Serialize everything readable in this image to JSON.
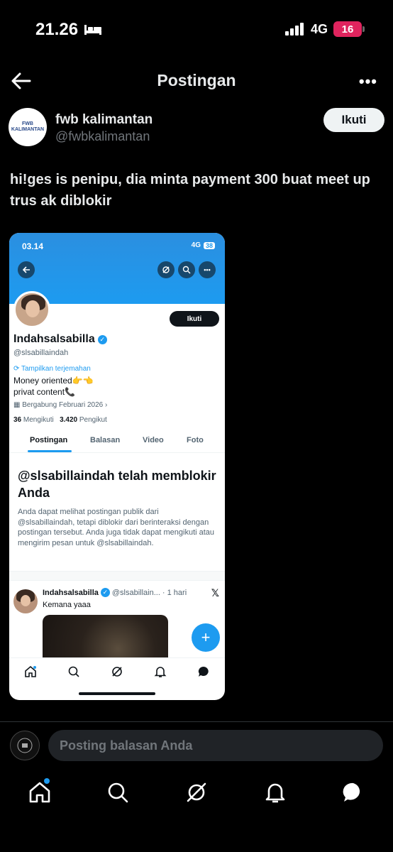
{
  "status_bar": {
    "time": "21.26",
    "network": "4G",
    "battery": "16"
  },
  "header": {
    "title": "Postingan"
  },
  "author": {
    "name": "fwb kalimantan",
    "handle": "@fwbkalimantan",
    "avatar_text": "FWB KALIMANTAN",
    "follow_label": "Ikuti"
  },
  "post": {
    "text": "hi!ges is penipu, dia minta payment 300 buat meet up trus ak diblokir"
  },
  "screenshot": {
    "status_time": "03.14",
    "status_network": "4G",
    "status_battery": "38",
    "profile": {
      "name": "Indahsalsabilla",
      "handle": "@slsabillaindah",
      "follow_label": "Ikuti",
      "translate": "Tampilkan terjemahan",
      "bio_line1": "Money oriented👉👈",
      "bio_line2": "privat content📞",
      "joined": "Bergabung Februari 2026",
      "following_count": "36",
      "following_label": "Mengikuti",
      "followers_count": "3.420",
      "followers_label": "Pengikut"
    },
    "tabs": [
      "Postingan",
      "Balasan",
      "Video",
      "Foto"
    ],
    "blocked_title": "@slsabillaindah telah memblokir Anda",
    "blocked_desc": "Anda dapat melihat postingan publik dari @slsabillaindah, tetapi diblokir dari berinteraksi dengan postingan tersebut. Anda juga tidak dapat mengikuti atau mengirim pesan untuk @slsabillaindah.",
    "tweet": {
      "name": "Indahsalsabilla",
      "handle": "@slsabillain...",
      "time": "· 1 hari",
      "text": "Kemana yaaa"
    },
    "fab": "+"
  },
  "reply": {
    "placeholder": "Posting balasan Anda"
  },
  "icons": [
    "back-arrow-icon",
    "more-icon",
    "home-icon",
    "search-icon",
    "grok-icon",
    "bell-icon",
    "message-icon"
  ],
  "colors": {
    "accent": "#1d9bf0",
    "background": "#000000",
    "battery_low": "#e0245e"
  }
}
